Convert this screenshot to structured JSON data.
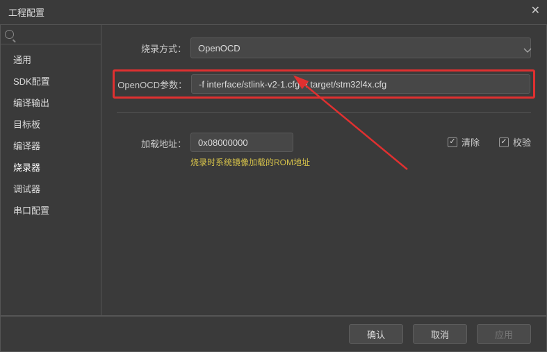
{
  "dialog": {
    "title": "工程配置"
  },
  "sidebar": {
    "items": [
      {
        "label": "通用"
      },
      {
        "label": "SDK配置"
      },
      {
        "label": "编译输出"
      },
      {
        "label": "目标板"
      },
      {
        "label": "编译器"
      },
      {
        "label": "烧录器"
      },
      {
        "label": "调试器"
      },
      {
        "label": "串口配置"
      }
    ],
    "selected_index": 5
  },
  "fields": {
    "burn_method_label": "烧录方式：",
    "burn_method_value": "OpenOCD",
    "openocd_args_label": "OpenOCD参数：",
    "openocd_args_value": "-f interface/stlink-v2-1.cfg -f target/stm32l4x.cfg",
    "load_addr_label": "加载地址：",
    "load_addr_value": "0x08000000",
    "load_hint": "烧录时系统镜像加载的ROM地址",
    "clear_label": "清除",
    "verify_label": "校验"
  },
  "buttons": {
    "ok": "确认",
    "cancel": "取消",
    "apply": "应用"
  },
  "annotation_color": "#e03030"
}
